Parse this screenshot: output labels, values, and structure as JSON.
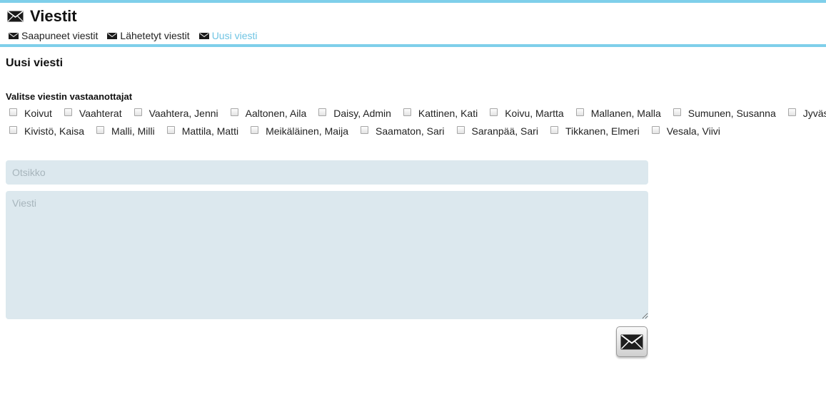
{
  "header": {
    "title": "Viestit",
    "nav": [
      {
        "label": "Saapuneet viestit",
        "icon": "envelope-icon",
        "active": false
      },
      {
        "label": "Lähetetyt viestit",
        "icon": "envelope-icon",
        "active": false
      },
      {
        "label": "Uusi viesti",
        "icon": "envelope-icon",
        "active": true
      }
    ]
  },
  "form": {
    "section_title": "Uusi viesti",
    "recipients_label": "Valitse viestin vastaanottajat",
    "recipients_row1": [
      "Koivut",
      "Vaahterat",
      "Vaahtera, Jenni",
      "Aaltonen, Aila",
      "Daisy, Admin",
      "Kattinen, Kati",
      "Koivu, Martta",
      "Mallanen, Malla",
      "Sumunen, Susanna",
      "Jyväskylä"
    ],
    "recipients_row2": [
      "Kivistö, Kaisa",
      "Malli, Milli",
      "Mattila, Matti",
      "Meikäläinen, Maija",
      "Saamaton, Sari",
      "Saranpää, Sari",
      "Tikkanen, Elmeri",
      "Vesala, Viivi"
    ],
    "title_placeholder": "Otsikko",
    "title_value": "",
    "body_placeholder": "Viesti",
    "body_value": "",
    "send_icon": "envelope-icon"
  },
  "colors": {
    "accent": "#7fcfea",
    "active_link": "#6fc4e3",
    "input_bg": "#dce8ee"
  }
}
